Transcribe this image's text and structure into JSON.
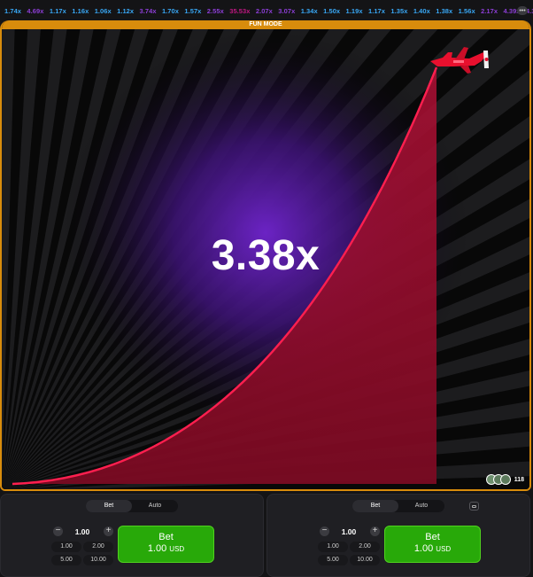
{
  "history": [
    {
      "v": "1.74x",
      "c": "#38a7f5"
    },
    {
      "v": "4.69x",
      "c": "#8c3ed6"
    },
    {
      "v": "1.17x",
      "c": "#38a7f5"
    },
    {
      "v": "1.16x",
      "c": "#38a7f5"
    },
    {
      "v": "1.06x",
      "c": "#38a7f5"
    },
    {
      "v": "1.12x",
      "c": "#38a7f5"
    },
    {
      "v": "3.74x",
      "c": "#8c3ed6"
    },
    {
      "v": "1.70x",
      "c": "#38a7f5"
    },
    {
      "v": "1.57x",
      "c": "#38a7f5"
    },
    {
      "v": "2.55x",
      "c": "#8c3ed6"
    },
    {
      "v": "35.53x",
      "c": "#c01782"
    },
    {
      "v": "2.07x",
      "c": "#8c3ed6"
    },
    {
      "v": "3.07x",
      "c": "#8c3ed6"
    },
    {
      "v": "1.34x",
      "c": "#38a7f5"
    },
    {
      "v": "1.50x",
      "c": "#38a7f5"
    },
    {
      "v": "1.19x",
      "c": "#38a7f5"
    },
    {
      "v": "1.17x",
      "c": "#38a7f5"
    },
    {
      "v": "1.35x",
      "c": "#38a7f5"
    },
    {
      "v": "1.40x",
      "c": "#38a7f5"
    },
    {
      "v": "1.38x",
      "c": "#38a7f5"
    },
    {
      "v": "1.56x",
      "c": "#38a7f5"
    },
    {
      "v": "2.17x",
      "c": "#8c3ed6"
    },
    {
      "v": "4.39x",
      "c": "#8c3ed6"
    },
    {
      "v": "4.35x",
      "c": "#8c3ed6"
    },
    {
      "v": "1.65x",
      "c": "#38a7f5"
    },
    {
      "v": "1.0",
      "c": "#38a7f5"
    }
  ],
  "history_more_icon": "more-dots-icon",
  "game": {
    "banner": "FUN MODE",
    "multiplier": "3.38x",
    "curve_color": "#ff1f4f",
    "fill_color": "#9e0d2c",
    "plane_color": "#e8102e",
    "glow_color": "#5a1fa0",
    "players_count": "118"
  },
  "panels": [
    {
      "tabs": [
        "Bet",
        "Auto"
      ],
      "active_tab": "Bet",
      "amount": "1.00",
      "quick": [
        "1.00",
        "2.00",
        "5.00",
        "10.00"
      ],
      "bet_label": "Bet",
      "bet_amount": "1.00",
      "bet_currency": "USD"
    },
    {
      "tabs": [
        "Bet",
        "Auto"
      ],
      "active_tab": "Bet",
      "amount": "1.00",
      "quick": [
        "1.00",
        "2.00",
        "5.00",
        "10.00"
      ],
      "bet_label": "Bet",
      "bet_amount": "1.00",
      "bet_currency": "USD"
    }
  ],
  "colors": {
    "accent": "#d88c0c",
    "bet_green": "#28a909"
  }
}
